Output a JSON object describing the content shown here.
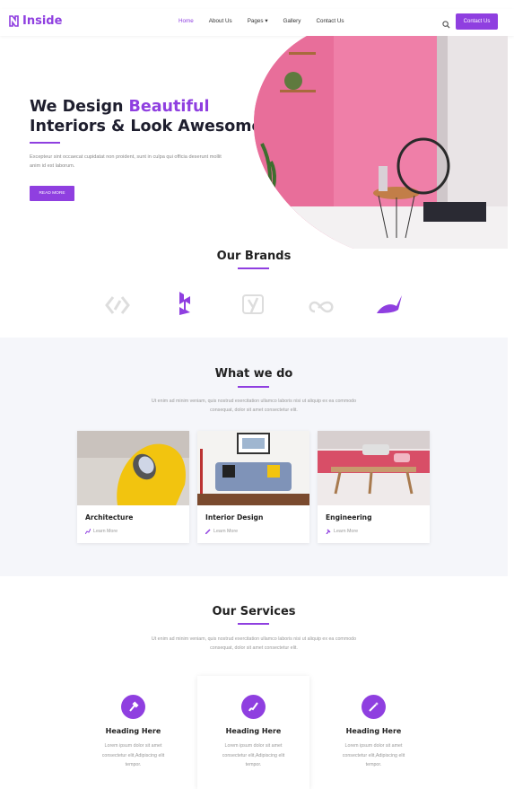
{
  "brand": {
    "name": "Inside",
    "accent": "#8f3fe0"
  },
  "nav": {
    "items": [
      "Home",
      "About Us",
      "Pages",
      "Gallery",
      "Contact Us"
    ],
    "pages_caret": "▾",
    "cta": "Contact Us"
  },
  "hero": {
    "title_line1_a": "We Design ",
    "title_line1_b": "Beautiful",
    "title_line2": "Interiors & Look Awesome",
    "text": "Excepteur sint occaecat cupidatat non proident, sunt in culpa qui officia deserunt mollit anim id est laborum.",
    "button": "READ MORE"
  },
  "brands_section": {
    "title": "Our Brands"
  },
  "what_we_do": {
    "title": "What we do",
    "desc_line1": "Ut enim ad minim veniam, quis nostrud exercitation ullamco laboris nisi ut aliquip ex ea commodo",
    "desc_line2": "consequat, dolor sit amet consectetur elit.",
    "cards": [
      {
        "title": "Architecture",
        "link": "Learn More"
      },
      {
        "title": "Interior Design",
        "link": "Learn More"
      },
      {
        "title": "Engineering",
        "link": "Learn More"
      }
    ]
  },
  "services": {
    "title": "Our Services",
    "desc_line1": "Ut enim ad minim veniam, quis nostrud exercitation ullamco laboris nisi ut aliquip ex ea commodo",
    "desc_line2": "consequat, dolor sit amet consectetur elit.",
    "items": [
      {
        "title": "Heading Here",
        "line1": "Lorem ipsum dolor sit amet",
        "line2": "consectetur elit,Adipiscing elit",
        "line3": "tempor."
      },
      {
        "title": "Heading Here",
        "line1": "Lorem ipsum dolor sit amet",
        "line2": "consectetur elit,Adipiscing elit",
        "line3": "tempor."
      },
      {
        "title": "Heading Here",
        "line1": "Lorem ipsum dolor sit amet",
        "line2": "consectetur elit,Adipiscing elit",
        "line3": "tempor."
      }
    ]
  }
}
